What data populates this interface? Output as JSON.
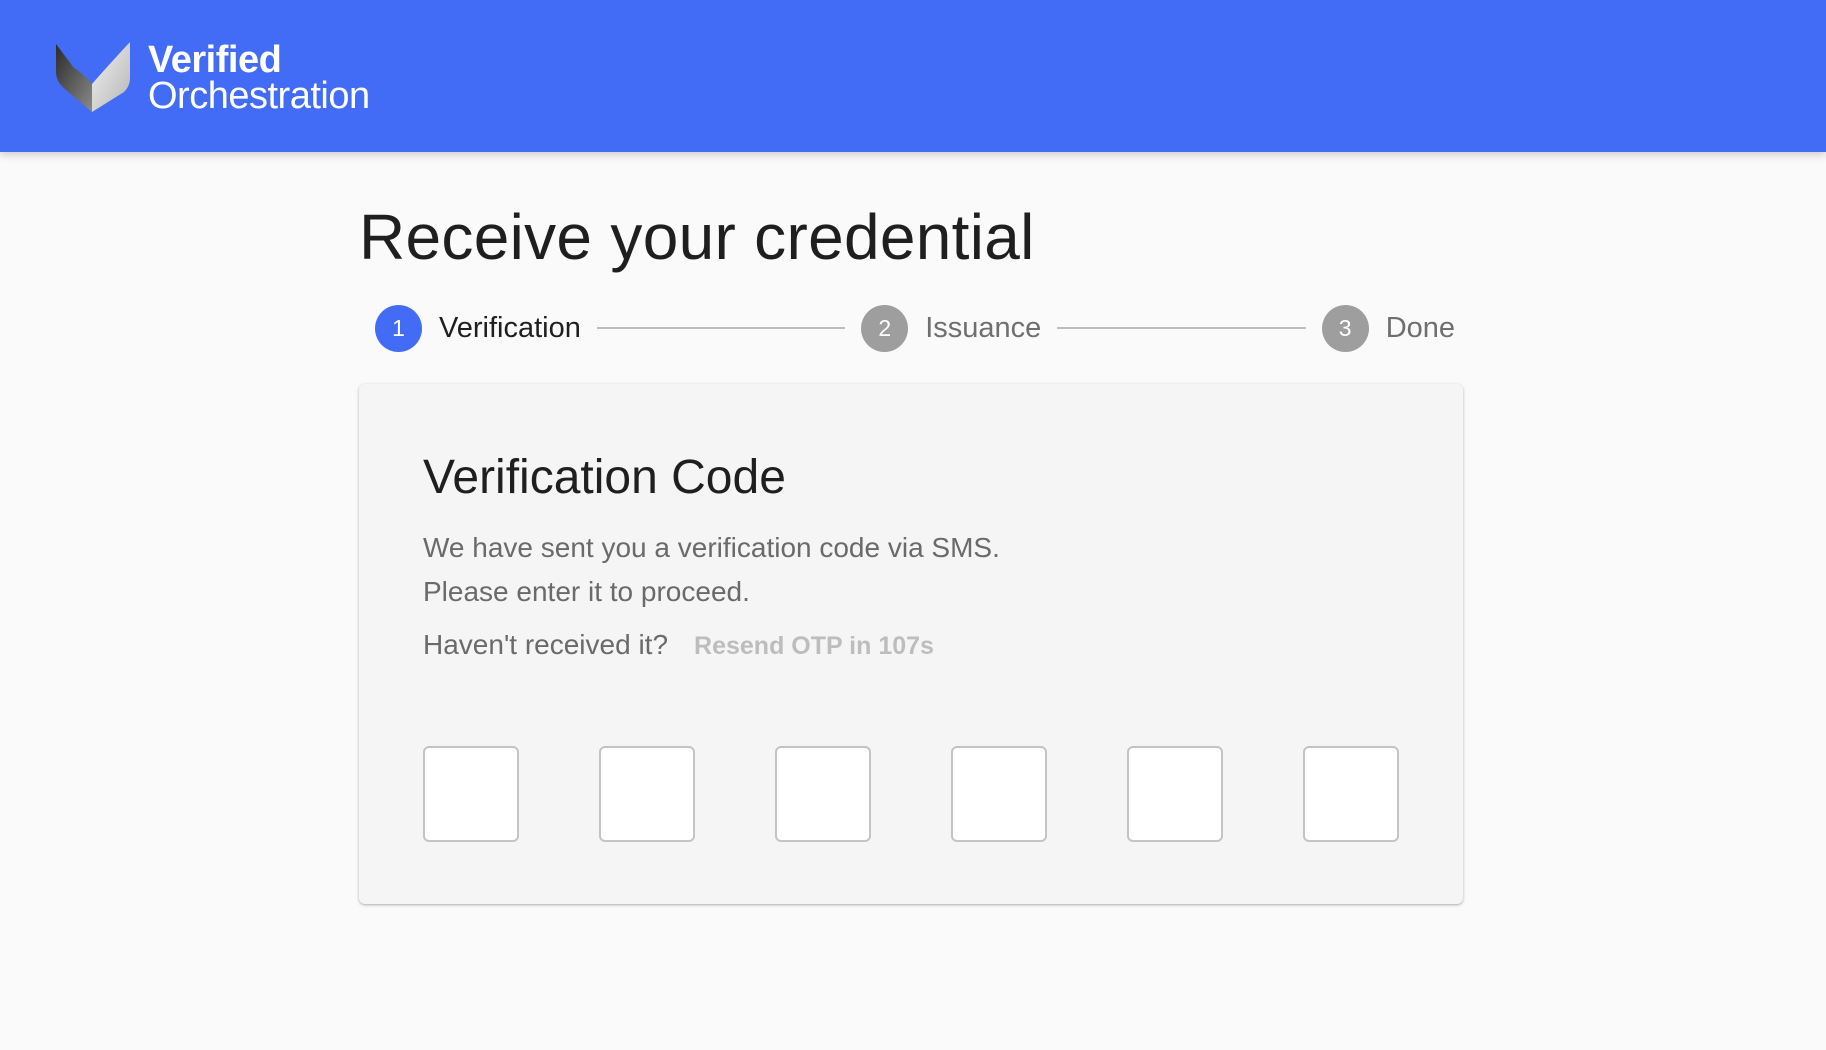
{
  "header": {
    "brand_line1": "Verified",
    "brand_line2": "Orchestration",
    "logo_icon": "checkmark-shield-logo",
    "background_color": "#436cf6"
  },
  "page": {
    "title": "Receive your credential"
  },
  "stepper": {
    "steps": [
      {
        "number": "1",
        "label": "Verification",
        "state": "active"
      },
      {
        "number": "2",
        "label": "Issuance",
        "state": "inactive"
      },
      {
        "number": "3",
        "label": "Done",
        "state": "inactive"
      }
    ],
    "active_color": "#436cf6",
    "inactive_color": "#9e9e9e"
  },
  "card": {
    "title": "Verification Code",
    "description_line1": "We have sent you a verification code via SMS.",
    "description_line2": "Please enter it to proceed.",
    "resend_question": "Haven't received it?",
    "resend_label": "Resend OTP in 107s",
    "otp_digits": [
      "",
      "",
      "",
      "",
      "",
      ""
    ]
  }
}
